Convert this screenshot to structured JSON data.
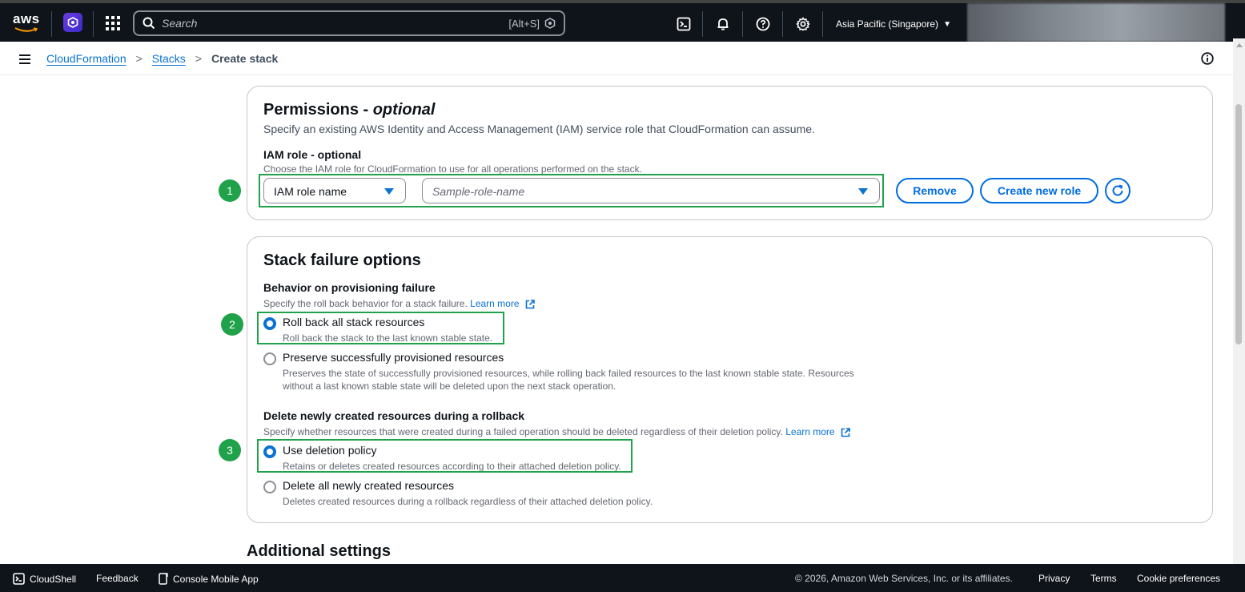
{
  "topnav": {
    "logo_text": "aws",
    "search_placeholder": "Search",
    "search_shortcut": "[Alt+S]",
    "region": "Asia Pacific (Singapore)",
    "icons": [
      "cloudshell-icon",
      "bell-icon",
      "help-icon",
      "settings-icon"
    ]
  },
  "breadcrumb": {
    "items": [
      "CloudFormation",
      "Stacks"
    ],
    "current": "Create stack"
  },
  "permissions": {
    "title": "Permissions - ",
    "title_optional": "optional",
    "description": "Specify an existing AWS Identity and Access Management (IAM) service role that CloudFormation can assume.",
    "iam_label": "IAM role - optional",
    "iam_desc": "Choose the IAM role for CloudFormation to use for all operations performed on the stack.",
    "role_type_value": "IAM role name",
    "role_placeholder": "Sample-role-name",
    "remove_label": "Remove",
    "create_label": "Create new role"
  },
  "stack_failure": {
    "title": "Stack failure options",
    "behavior_label": "Behavior on provisioning failure",
    "behavior_desc": "Specify the roll back behavior for a stack failure.",
    "learn_more": "Learn more",
    "options": [
      {
        "label": "Roll back all stack resources",
        "desc": "Roll back the stack to the last known stable state.",
        "checked": true
      },
      {
        "label": "Preserve successfully provisioned resources",
        "desc1": "Preserves the state of successfully provisioned resources, while rolling back failed resources to the last known stable state. Resources",
        "desc2": "without a last known stable state will be deleted upon the next stack operation.",
        "checked": false
      }
    ],
    "delete_label": "Delete newly created resources during a rollback",
    "delete_desc": "Specify whether resources that were created during a failed operation should be deleted regardless of their deletion policy.",
    "delete_options": [
      {
        "label": "Use deletion policy",
        "desc": "Retains or deletes created resources according to their attached deletion policy.",
        "checked": true
      },
      {
        "label": "Delete all newly created resources",
        "desc": "Deletes created resources during a rollback regardless of their attached deletion policy.",
        "checked": false
      }
    ]
  },
  "annotations": [
    "1",
    "2",
    "3"
  ],
  "additional_settings": "Additional settings",
  "footer": {
    "cloudshell": "CloudShell",
    "feedback": "Feedback",
    "mobile_app": "Console Mobile App",
    "copyright": "© 2026, Amazon Web Services, Inc. or its affiliates.",
    "privacy": "Privacy",
    "terms": "Terms",
    "cookies": "Cookie preferences"
  },
  "colors": {
    "nav_bg": "#0f141a",
    "link": "#0972d3",
    "annotation": "#1fa24a"
  }
}
